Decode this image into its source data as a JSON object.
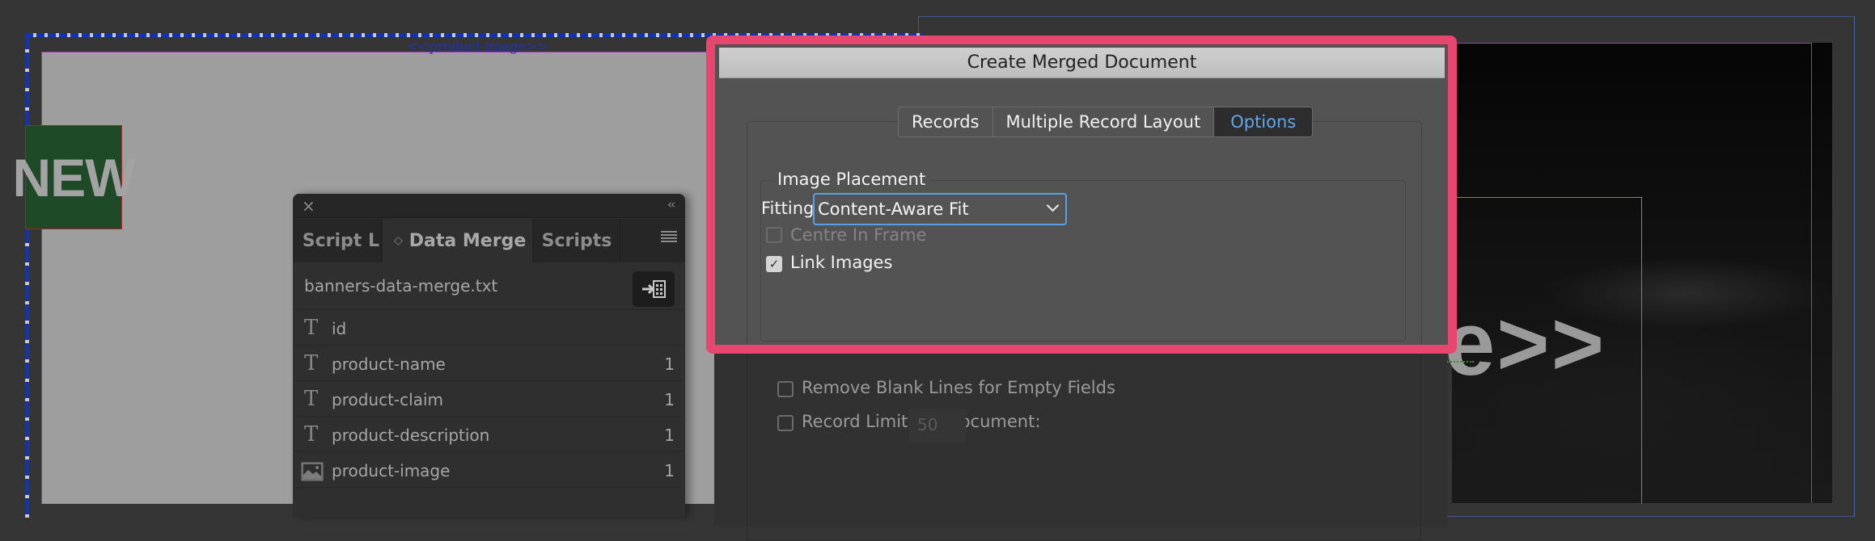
{
  "canvas": {
    "page_placeholder_label": "<<product-image>>",
    "badge_text": "NEW",
    "overflow_text": "e>>"
  },
  "data_merge_panel": {
    "close_glyph": "×",
    "collapse_glyph": "‹‹",
    "tabs": [
      {
        "label": "Script L",
        "active": false
      },
      {
        "label": "Data Merge",
        "active": true
      },
      {
        "label": "Scripts",
        "active": false
      }
    ],
    "data_source": "banners-data-merge.txt",
    "fields": [
      {
        "type": "text",
        "icon": "T",
        "name": "id",
        "count": ""
      },
      {
        "type": "text",
        "icon": "T",
        "name": "product-name",
        "count": "1"
      },
      {
        "type": "text",
        "icon": "T",
        "name": "product-claim",
        "count": "1"
      },
      {
        "type": "text",
        "icon": "T",
        "name": "product-description",
        "count": "1"
      },
      {
        "type": "image",
        "icon": "image",
        "name": "product-image",
        "count": "1"
      }
    ]
  },
  "dialog": {
    "title": "Create Merged Document",
    "tabs": [
      {
        "label": "Records",
        "active": false
      },
      {
        "label": "Multiple Record Layout",
        "active": false
      },
      {
        "label": "Options",
        "active": true
      }
    ],
    "image_placement": {
      "legend": "Image Placement",
      "fitting_label": "Fitting:",
      "fitting_value": "Content-Aware Fit",
      "centre_in_frame": {
        "label": "Centre In Frame",
        "checked": false,
        "enabled": false
      },
      "link_images": {
        "label": "Link Images",
        "checked": true,
        "enabled": true
      }
    },
    "remove_blank_lines": {
      "label": "Remove Blank Lines for Empty Fields",
      "checked": false
    },
    "record_limit": {
      "label": "Record Limit per Document:",
      "checked": false,
      "value": "50"
    },
    "highlight_color": "#e8466f",
    "accent_color": "#5fa6ee"
  }
}
